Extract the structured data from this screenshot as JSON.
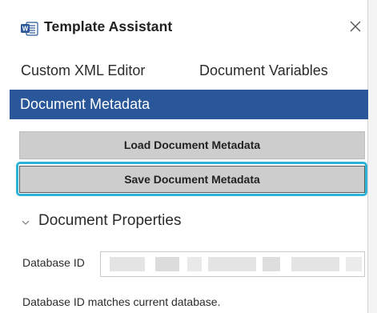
{
  "app": {
    "title": "Template Assistant",
    "icon": "word-document-icon",
    "close_icon": "close-icon"
  },
  "tabs": [
    {
      "label": "Custom XML Editor",
      "selected": false
    },
    {
      "label": "Document Variables",
      "selected": false
    },
    {
      "label": "Document Metadata",
      "selected": true
    }
  ],
  "buttons": {
    "load_label": "Load Document Metadata",
    "save_label": "Save Document Metadata"
  },
  "section": {
    "title": "Document Properties",
    "expanded": true
  },
  "fields": {
    "database_id": {
      "label": "Database ID",
      "value_redacted": true
    }
  },
  "status": "Database ID matches current database.",
  "colors": {
    "accent": "#2a579a",
    "focus_ring": "#2bb4d6",
    "button_bg": "#cdcdcd",
    "word_blue": "#2b579a"
  }
}
